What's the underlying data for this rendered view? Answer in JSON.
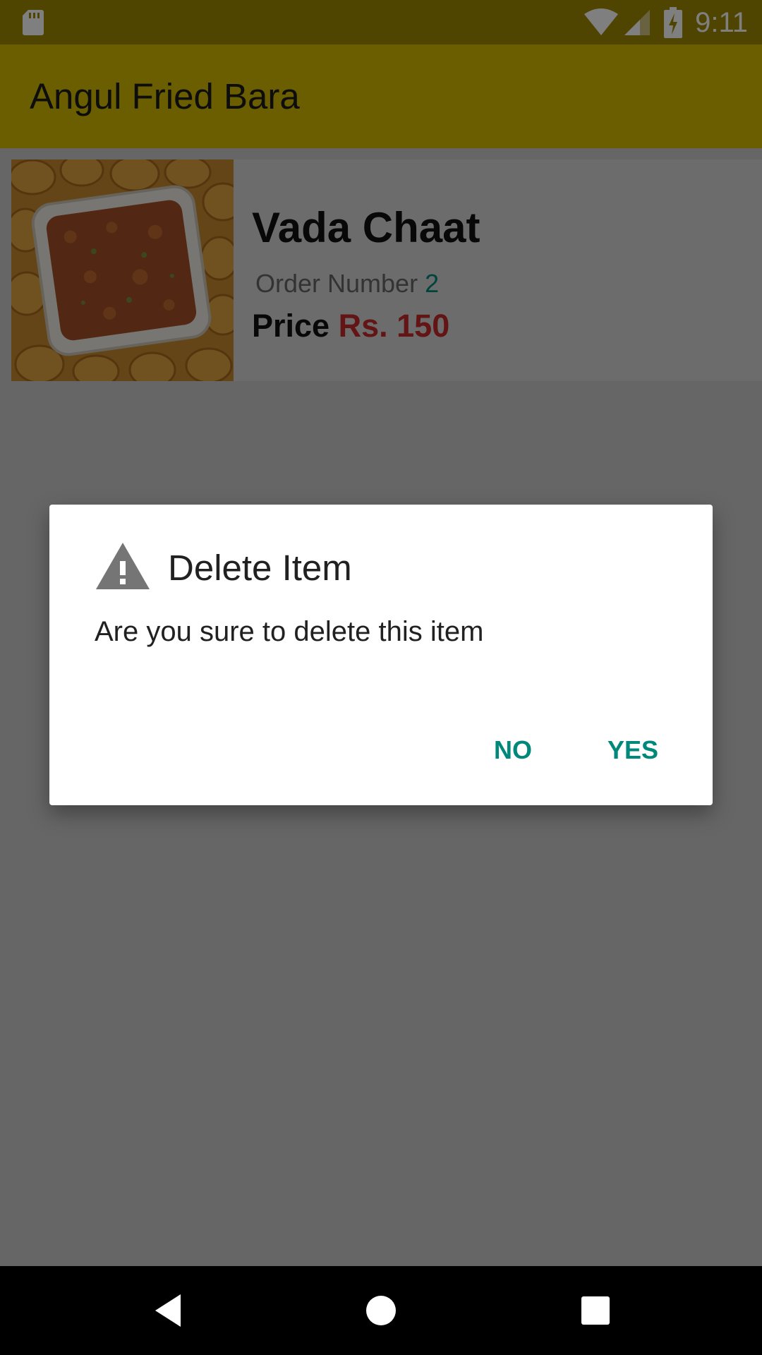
{
  "status_bar": {
    "time": "9:11",
    "icons": [
      "sd-card-icon",
      "wifi-icon",
      "signal-icon",
      "battery-charging-icon"
    ]
  },
  "app_bar": {
    "title": "Angul Fried Bara"
  },
  "order_item": {
    "image_icon": "food-photo",
    "name": "Vada Chaat",
    "order_number_label": "Order Number",
    "order_number_value": "2",
    "price_label": "Price",
    "price_value": "Rs. 150"
  },
  "dialog": {
    "icon": "warning-icon",
    "title": "Delete Item",
    "message": "Are you sure to delete this item",
    "no_label": "NO",
    "yes_label": "YES"
  },
  "nav_bar": {
    "icons": [
      "back-icon",
      "home-icon",
      "recents-icon"
    ]
  },
  "colors": {
    "accent": "#00897b",
    "price": "#c62828",
    "app_bar": "#d4bc00",
    "status_bar": "#a08a00"
  }
}
